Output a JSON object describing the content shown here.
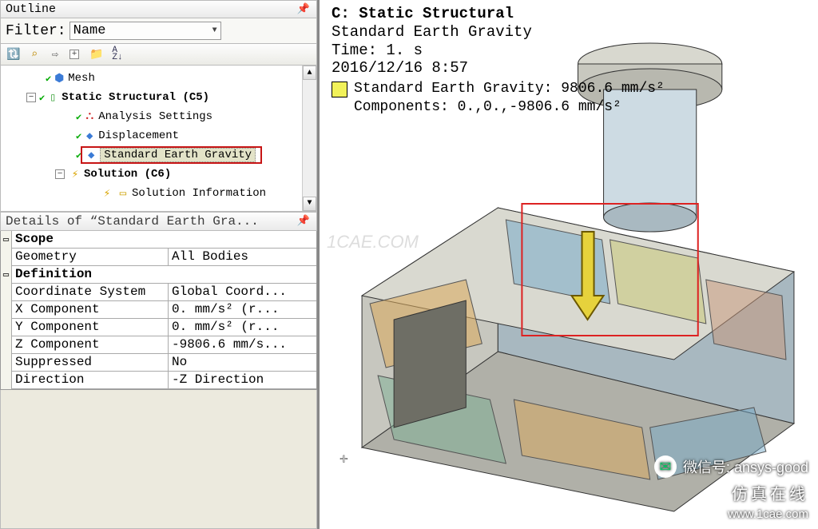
{
  "outline": {
    "title": "Outline",
    "filter_label": "Filter:",
    "filter_value": "Name",
    "tree": {
      "mesh": "Mesh",
      "static_structural": "Static Structural (C5)",
      "analysis_settings": "Analysis Settings",
      "displacement": "Displacement",
      "std_earth_gravity": "Standard Earth Gravity",
      "solution": "Solution (C6)",
      "solution_info": "Solution Information"
    }
  },
  "details": {
    "title": "Details of “Standard Earth Gra...",
    "sections": {
      "scope": "Scope",
      "definition": "Definition"
    },
    "rows": {
      "geometry_k": "Geometry",
      "geometry_v": "All Bodies",
      "coord_k": "Coordinate System",
      "coord_v": "Global Coord...",
      "x_k": "X Component",
      "x_v": "0. mm/s²  (r...",
      "y_k": "Y Component",
      "y_v": "0. mm/s²  (r...",
      "z_k": "Z Component",
      "z_v": "-9806.6 mm/s...",
      "sup_k": "Suppressed",
      "sup_v": "No",
      "dir_k": "Direction",
      "dir_v": "-Z Direction"
    }
  },
  "viewport": {
    "heading_system": "C: Static Structural",
    "heading_load": "Standard Earth Gravity",
    "heading_time": "Time: 1. s",
    "heading_date": "2016/12/16 8:57",
    "legend_line1": "Standard Earth Gravity: 9806.6 mm/s²",
    "legend_line2": "Components: 0.,0.,-9806.6 mm/s²",
    "watermark": "1CAE.COM",
    "wechat_label": "微信号: ansys-good",
    "brand_line1": "仿真在线",
    "brand_line2": "www.1cae.com"
  }
}
